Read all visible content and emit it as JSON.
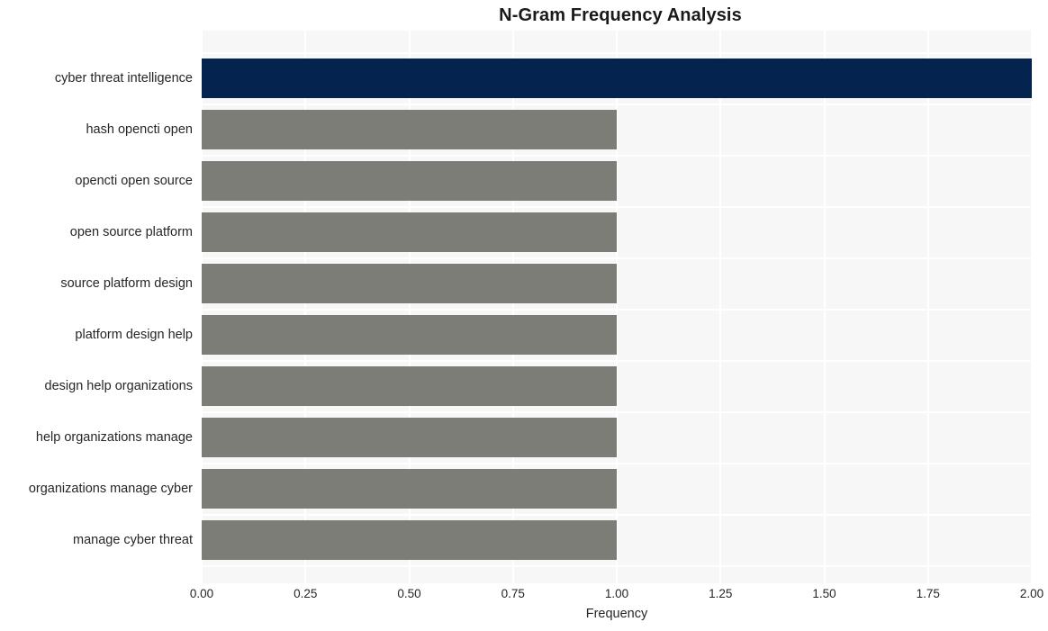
{
  "chart_data": {
    "type": "bar",
    "orientation": "horizontal",
    "title": "N-Gram Frequency Analysis",
    "xlabel": "Frequency",
    "ylabel": "",
    "categories": [
      "cyber threat intelligence",
      "hash opencti open",
      "opencti open source",
      "open source platform",
      "source platform design",
      "platform design help",
      "design help organizations",
      "help organizations manage",
      "organizations manage cyber",
      "manage cyber threat"
    ],
    "values": [
      2,
      1,
      1,
      1,
      1,
      1,
      1,
      1,
      1,
      1
    ],
    "bar_colors": [
      "#04244f",
      "#7d7d78",
      "#7d7d78",
      "#7d7d78",
      "#7d7d78",
      "#7d7d78",
      "#7d7d78",
      "#7d7d78",
      "#7d7d78",
      "#7d7d78"
    ],
    "xlim": [
      0,
      2.0
    ],
    "xticks": [
      0,
      0.25,
      0.5,
      0.75,
      1.0,
      1.25,
      1.5,
      1.75,
      2.0
    ],
    "xtick_labels": [
      "0.00",
      "0.25",
      "0.50",
      "0.75",
      "1.00",
      "1.25",
      "1.50",
      "1.75",
      "2.00"
    ],
    "grid": true,
    "grid_color": "#ffffff",
    "plot_background": "#f7f7f7",
    "figure_background": "#ffffff",
    "legend": null,
    "highlight_color": "#04244f",
    "default_color": "#7d7d78"
  }
}
